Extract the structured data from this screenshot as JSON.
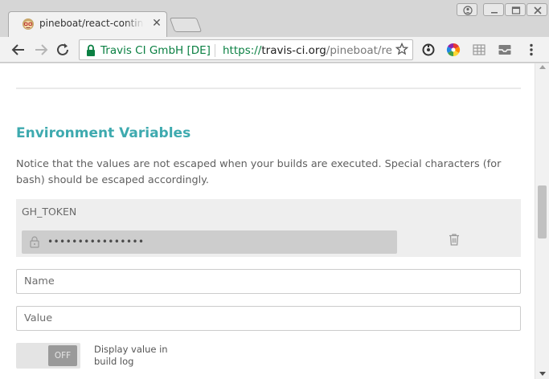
{
  "browser": {
    "tab": {
      "title": "pineboat/react-continuous-deployment",
      "favicon": "travis-mascot-icon"
    },
    "omnibox": {
      "ev_name": "Travis CI GmbH [DE]",
      "url_scheme": "https://",
      "url_host": "travis-ci.org",
      "url_path": "/pineboat/react-continuous-deployment/settings"
    },
    "icons": [
      "back-icon",
      "forward-icon",
      "reload-icon",
      "lock-icon",
      "star-icon",
      "sync-extension-icon",
      "color-wheel-extension-icon",
      "grid-extension-icon",
      "inbox-extension-icon",
      "menu-icon"
    ],
    "colors": {
      "secure": "#0b8043",
      "accent": "#3eaaaf"
    }
  },
  "page": {
    "section_title": "Environment Variables",
    "notice": "Notice that the values are not escaped when your builds are executed. Special characters (for bash) should be escaped accordingly.",
    "env_vars": [
      {
        "name": "GH_TOKEN",
        "value": "••••••••••••••••"
      }
    ],
    "form": {
      "name_placeholder": "Name",
      "value_placeholder": "Value",
      "toggle_state": "OFF",
      "toggle_label": "Display value in build log"
    }
  }
}
